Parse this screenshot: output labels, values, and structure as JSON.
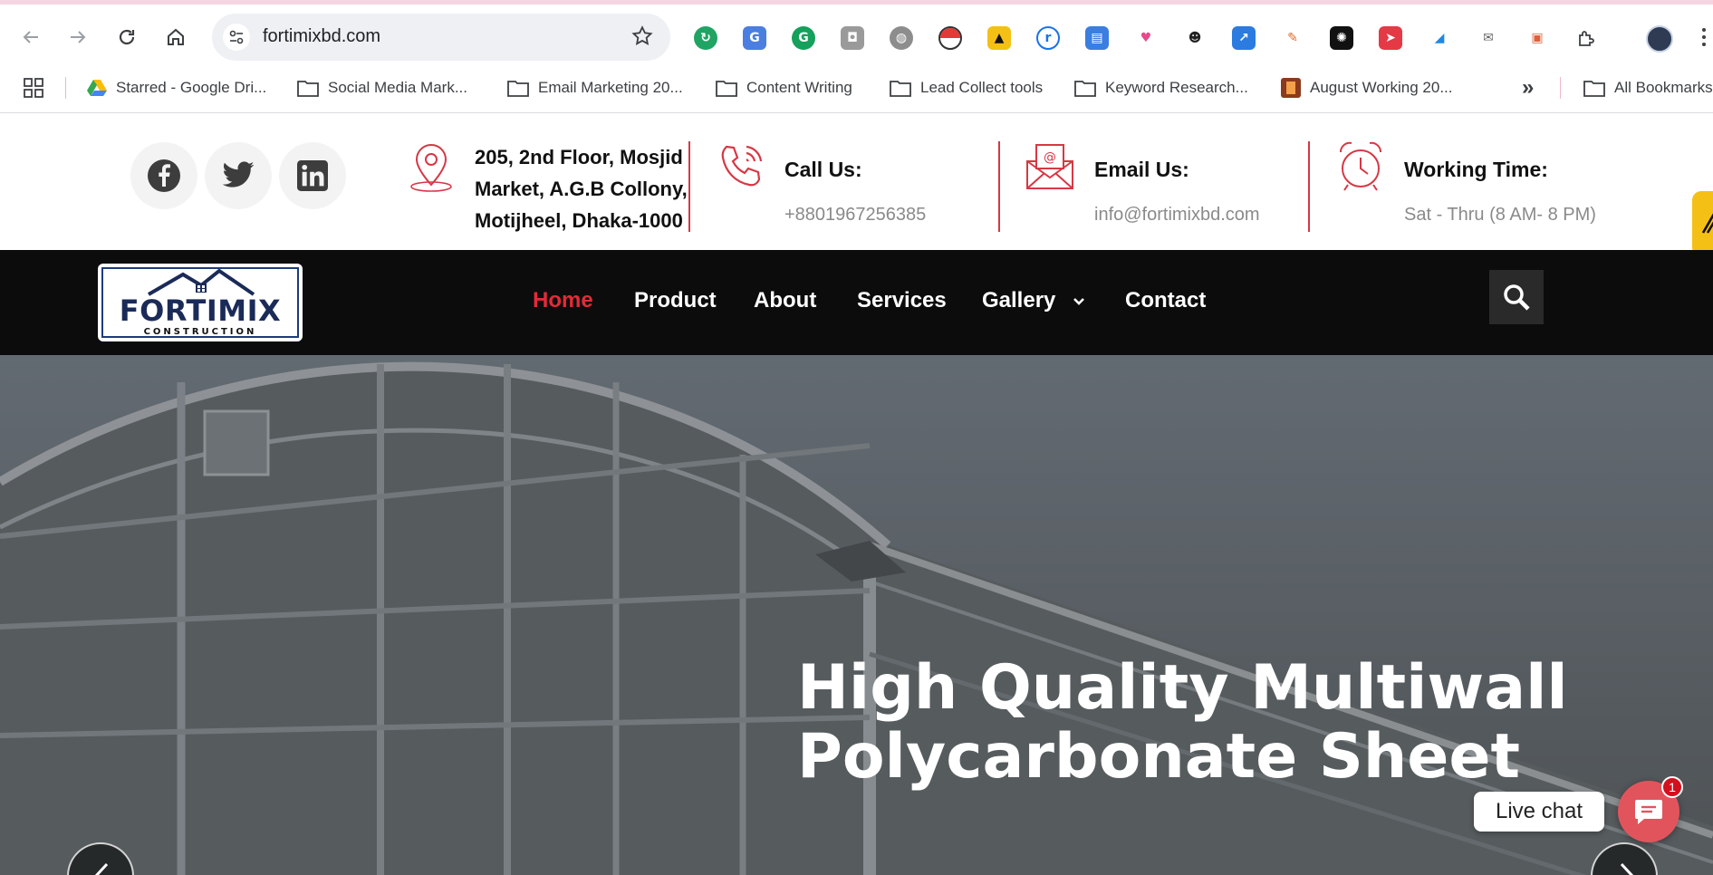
{
  "browser": {
    "url": "fortimixbd.com",
    "bookmarks": [
      {
        "label": "Starred - Google Dri..."
      },
      {
        "label": "Social Media Mark..."
      },
      {
        "label": "Email Marketing 20..."
      },
      {
        "label": "Content Writing"
      },
      {
        "label": "Lead Collect tools"
      },
      {
        "label": "Keyword Research..."
      },
      {
        "label": "August Working 20..."
      }
    ],
    "more_label": "»",
    "all_bookmarks_label": "All Bookmarks",
    "extensions": [
      "refresh-ext-icon",
      "translate-icon",
      "grammarly-icon",
      "camera-icon",
      "globe-icon",
      "pokeball-icon",
      "ahrefs-icon",
      "r-ext-icon",
      "reader-icon",
      "heart-icon",
      "spy-icon",
      "arrow-ext-icon",
      "dropper-icon",
      "chatgpt-icon",
      "send-icon",
      "tasks-icon",
      "mail-icon",
      "screen-icon",
      "puzzle-icon"
    ]
  },
  "site": {
    "address": "205, 2nd Floor, Mosjid Market, A.G.B Collony, Motijheel, Dhaka-1000",
    "call_title": "Call Us:",
    "call_value": "+8801967256385",
    "email_title": "Email Us:",
    "email_value": "info@fortimixbd.com",
    "time_title": "Working Time:",
    "time_value": "Sat - Thru (8 AM- 8 PM)",
    "logo": {
      "title": "FORTIMIX",
      "subtitle": "CONSTRUCTION"
    },
    "menu": [
      {
        "label": "Home",
        "active": true
      },
      {
        "label": "Product"
      },
      {
        "label": "About"
      },
      {
        "label": "Services"
      },
      {
        "label": "Gallery"
      },
      {
        "label": "Contact"
      }
    ],
    "hero_title_line1": "High Quality Multiwall",
    "hero_title_line2": "Polycarbonate Sheet",
    "live_chat_label": "Live chat",
    "chat_badge": "1"
  },
  "colors": {
    "accent_red": "#e12b38",
    "nav_bg": "#0c0c0c",
    "logo_blue": "#1b2b58"
  }
}
